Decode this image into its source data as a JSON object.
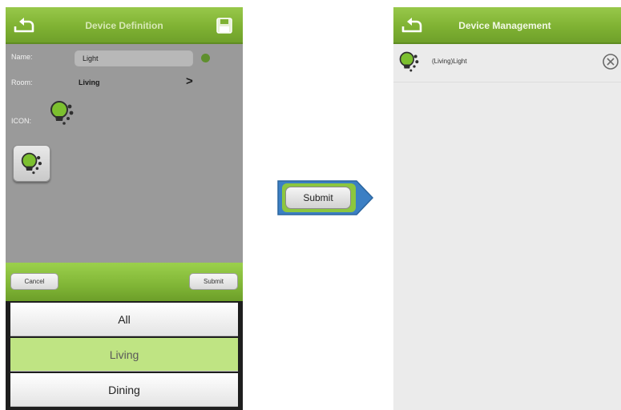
{
  "left_screen": {
    "title": "Device Definition",
    "back_icon": "back-arrow-icon",
    "save_icon": "floppy-save-icon",
    "name_label": "Name:",
    "name_value": "Light",
    "room_label": "Room:",
    "room_value": "Living",
    "room_chevron": ">",
    "icon_label": "ICON:",
    "device_icon": "lightbulb-icon",
    "cancel_label": "Cancel",
    "submit_label": "Submit",
    "room_options": [
      "All",
      "Living",
      "Dining"
    ],
    "selected_room": "Living"
  },
  "callout": {
    "label": "Submit",
    "arrow_color": "#3b7fc4"
  },
  "right_screen": {
    "title": "Device Management",
    "back_icon": "back-arrow-icon",
    "devices": [
      {
        "label": "(Living)Light",
        "icon": "lightbulb-icon",
        "action_icon": "remove-circle-icon"
      }
    ]
  },
  "colors": {
    "header_green": "#7fb233",
    "selected_row": "#bfe483",
    "bulb_green": "#7cc02f"
  }
}
